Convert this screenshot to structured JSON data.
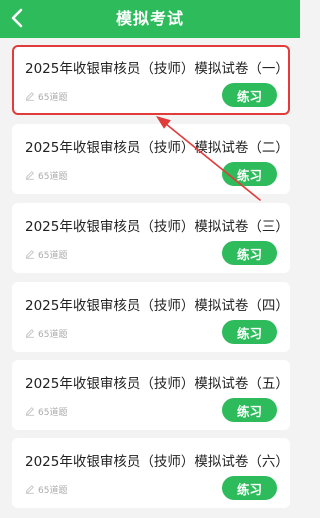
{
  "header": {
    "title": "模拟考试",
    "back_icon": "chevron-left-icon"
  },
  "colors": {
    "brand": "#2dbb5b",
    "highlight": "#e23b3b",
    "background": "#f3f3f3"
  },
  "exams": [
    {
      "title": "2025年收银审核员（技师）模拟试卷（一）",
      "count": "65道题",
      "button": "练习",
      "highlighted": true
    },
    {
      "title": "2025年收银审核员（技师）模拟试卷（二）",
      "count": "65道题",
      "button": "练习",
      "highlighted": false
    },
    {
      "title": "2025年收银审核员（技师）模拟试卷（三）",
      "count": "65道题",
      "button": "练习",
      "highlighted": false
    },
    {
      "title": "2025年收银审核员（技师）模拟试卷（四）",
      "count": "65道题",
      "button": "练习",
      "highlighted": false
    },
    {
      "title": "2025年收银审核员（技师）模拟试卷（五）",
      "count": "65道题",
      "button": "练习",
      "highlighted": false
    },
    {
      "title": "2025年收银审核员（技师）模拟试卷（六）",
      "count": "65道题",
      "button": "练习",
      "highlighted": false
    }
  ]
}
